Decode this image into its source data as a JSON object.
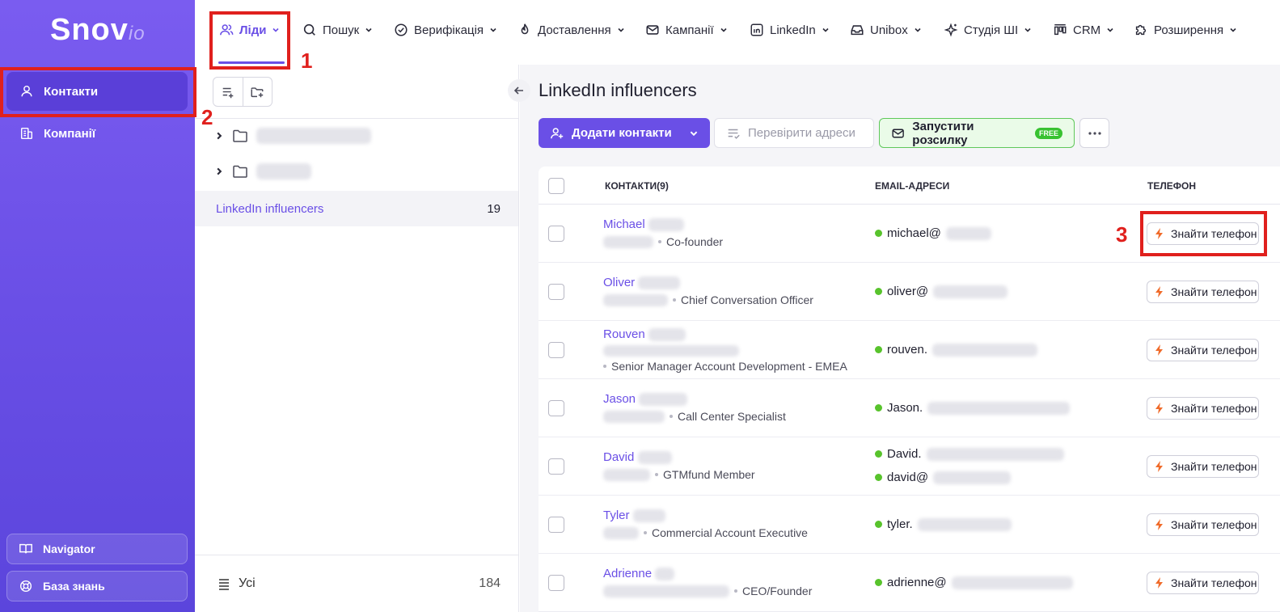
{
  "sidebar": {
    "logo_main": "Snov",
    "logo_suffix": "io",
    "items": [
      {
        "label": "Контакти",
        "icon": "user-icon"
      },
      {
        "label": "Компанії",
        "icon": "building-icon"
      }
    ],
    "bottom": [
      {
        "label": "Navigator",
        "icon": "book-icon"
      },
      {
        "label": "База знань",
        "icon": "lifebuoy-icon"
      }
    ]
  },
  "topnav": {
    "items": [
      {
        "label": "Ліди",
        "icon": "users-icon"
      },
      {
        "label": "Пошук",
        "icon": "search-icon"
      },
      {
        "label": "Верифікація",
        "icon": "check-circle-icon"
      },
      {
        "label": "Доставлення",
        "icon": "flame-icon"
      },
      {
        "label": "Кампанії",
        "icon": "mail-icon"
      },
      {
        "label": "LinkedIn",
        "icon": "linkedin-icon"
      },
      {
        "label": "Unibox",
        "icon": "inbox-icon"
      },
      {
        "label": "Студія ШІ",
        "icon": "sparkle-icon"
      },
      {
        "label": "CRM",
        "icon": "kanban-icon"
      },
      {
        "label": "Розширення",
        "icon": "puzzle-icon"
      }
    ]
  },
  "annotations": [
    "1",
    "2",
    "3"
  ],
  "folders": {
    "selected_list": {
      "name": "LinkedIn influencers",
      "count": "19"
    },
    "all": {
      "label": "Усі",
      "count": "184"
    }
  },
  "main": {
    "title": "LinkedIn influencers",
    "add_contacts": "Додати контакти",
    "verify_addresses": "Перевірити адреси",
    "launch_campaign": "Запустити розсилку",
    "free_badge": "FREE",
    "columns": {
      "contacts": "КОНТАКТИ(9)",
      "emails": "EMAIL-АДРЕСИ",
      "phone": "ТЕЛЕФОН"
    },
    "find_phone": "Знайти телефон",
    "rows": [
      {
        "name": "Michael",
        "title": "Co-founder",
        "emails": [
          "michael@"
        ]
      },
      {
        "name": "Oliver",
        "title": "Chief Conversation Officer",
        "emails": [
          "oliver@"
        ]
      },
      {
        "name": "Rouven",
        "title": "Senior Manager Account Development - EMEA",
        "emails": [
          "rouven."
        ]
      },
      {
        "name": "Jason",
        "title": "Call Center Specialist",
        "emails": [
          "Jason."
        ]
      },
      {
        "name": "David",
        "title": "GTMfund Member",
        "emails": [
          "David.",
          "david@"
        ]
      },
      {
        "name": "Tyler",
        "title": "Commercial Account Executive",
        "emails": [
          "tyler."
        ]
      },
      {
        "name": "Adrienne",
        "title": "CEO/Founder",
        "emails": [
          "adrienne@"
        ]
      }
    ]
  }
}
